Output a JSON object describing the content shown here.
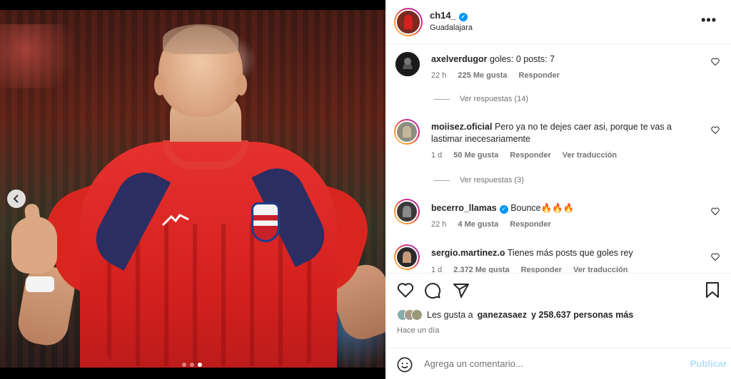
{
  "post": {
    "username": "ch14_",
    "location": "Guadalajara",
    "more_label": "•••",
    "likes_prefix": "Les gusta a",
    "likes_user": "ganezasaez",
    "likes_suffix": "y 258.637 personas más",
    "time_ago": "Hace un día",
    "comment_placeholder": "Agrega un comentario...",
    "publish_label": "Publicar",
    "carousel": {
      "dots": 3,
      "active_index": 2
    }
  },
  "comments": [
    {
      "username": "axelverdugor",
      "text": "goles: 0 posts: 7",
      "time": "22 h",
      "likes": "225 Me gusta",
      "reply": "Responder",
      "translate": "",
      "view_replies": "Ver respuestas (14)"
    },
    {
      "username": "moiisez.oficial",
      "text": "Pero ya no te dejes caer asi, porque te vas a lastimar inecesariamente",
      "time": "1 d",
      "likes": "50 Me gusta",
      "reply": "Responder",
      "translate": "Ver traducción",
      "view_replies": "Ver respuestas (3)"
    },
    {
      "username": "becerro_llamas",
      "text": "Bounce🔥🔥🔥",
      "time": "22 h",
      "likes": "4 Me gusta",
      "reply": "Responder",
      "translate": "",
      "view_replies": ""
    },
    {
      "username": "sergio.martinez.o",
      "text": "Tienes más posts que goles rey",
      "time": "1 d",
      "likes": "2.372 Me gusta",
      "reply": "Responder",
      "translate": "Ver traducción",
      "view_replies": ""
    }
  ],
  "colors": {
    "verified": "#0095f6",
    "publish_disabled": "#b2dffc",
    "story_ring": [
      "#feda75",
      "#fa7e1e",
      "#d62976",
      "#962fbf"
    ]
  },
  "icons": {
    "like": "heart-icon",
    "comment": "comment-icon",
    "share": "send-icon",
    "save": "bookmark-icon",
    "emoji": "emoji-icon",
    "prev": "chevron-left-icon",
    "verified": "verified-badge-icon"
  }
}
